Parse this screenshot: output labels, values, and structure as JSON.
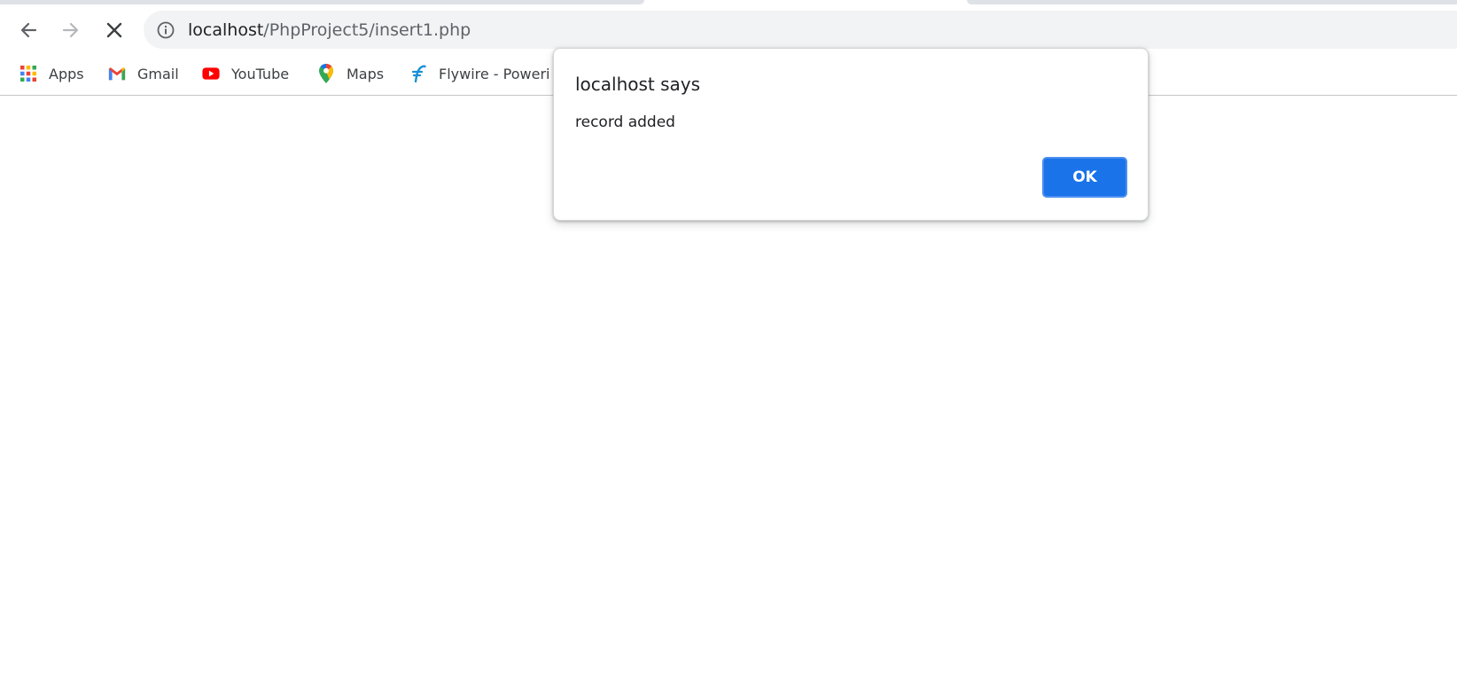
{
  "browser": {
    "address_bar": {
      "host": "localhost",
      "path": "/PhpProject5/insert1.php"
    },
    "nav": {
      "back_icon": "arrow-left-icon",
      "forward_icon": "arrow-right-icon",
      "stop_icon": "close-icon",
      "info_icon": "info-circle-icon"
    },
    "bookmarks": [
      {
        "label": "Apps",
        "icon": "apps-grid-icon"
      },
      {
        "label": "Gmail",
        "icon": "gmail-icon"
      },
      {
        "label": "YouTube",
        "icon": "youtube-icon"
      },
      {
        "label": "Maps",
        "icon": "maps-pin-icon"
      },
      {
        "label": "Flywire - Poweri",
        "icon": "flywire-icon"
      }
    ]
  },
  "dialog": {
    "title": "localhost says",
    "message": "record added",
    "ok_label": "OK"
  },
  "colors": {
    "accent": "#1a73e8",
    "omnibox_bg": "#f1f3f4",
    "text_primary": "#202124",
    "text_secondary": "#5f6368"
  }
}
